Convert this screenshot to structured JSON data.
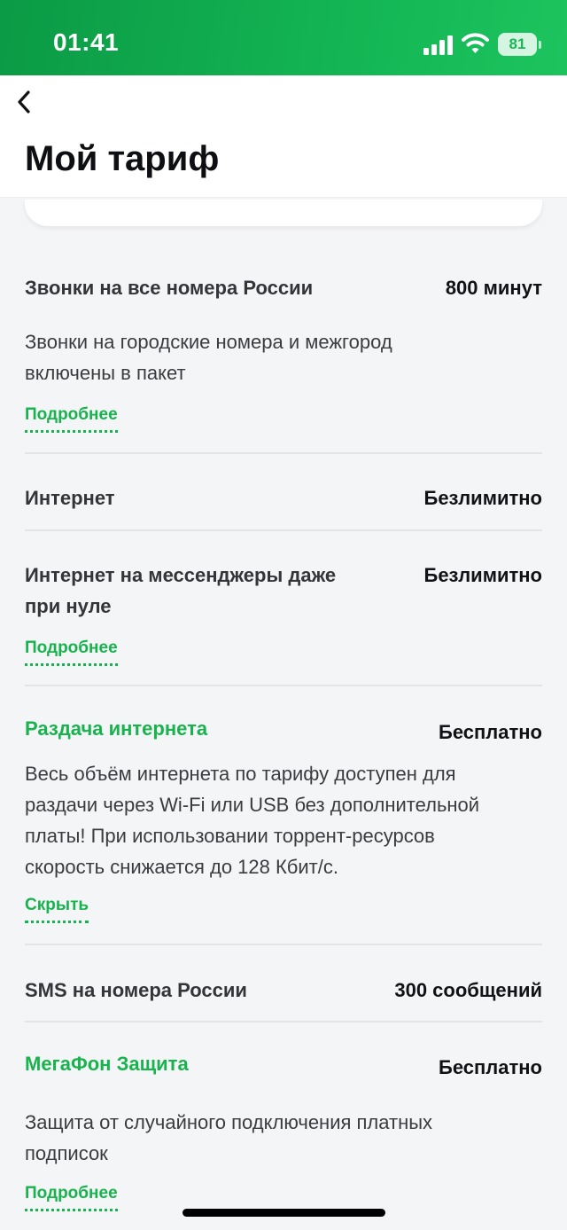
{
  "status_bar": {
    "time": "01:41",
    "battery": "81",
    "icons": [
      "signal-icon",
      "wifi-icon",
      "battery-charging-icon"
    ]
  },
  "header": {
    "back_icon": "chevron-left-icon",
    "title": "Мой тариф"
  },
  "colors": {
    "accent": "#18b24e",
    "status_bar_start": "#0b9a45",
    "status_bar_end": "#1dc45e"
  },
  "items": [
    {
      "title": "Звонки на все номера России",
      "value": "800 минут",
      "description_lines": [
        "Звонки на городские номера и межгород",
        "включены в пакет"
      ],
      "link": "Подробнее"
    },
    {
      "title": "Интернет",
      "value": "Безлимитно"
    },
    {
      "title_lines": [
        "Интернет на мессенджеры даже",
        "при нуле"
      ],
      "value": "Безлимитно",
      "link": "Подробнее"
    },
    {
      "title": "Раздача интернета",
      "value": "Бесплатно",
      "description_lines": [
        "Весь объём интернета по тарифу доступен для",
        "раздачи через Wi-Fi или USB без дополнительной",
        "платы! При использовании торрент-ресурсов",
        "скорость снижается до 128 Кбит/с."
      ],
      "link": "Скрыть"
    },
    {
      "title": "SMS на номера России",
      "value": "300 сообщений"
    },
    {
      "title": "МегаФон Защита",
      "value": "Бесплатно",
      "description_lines": [
        "Защита от случайного подключения платных",
        "подписок"
      ],
      "link": "Подробнее"
    }
  ]
}
